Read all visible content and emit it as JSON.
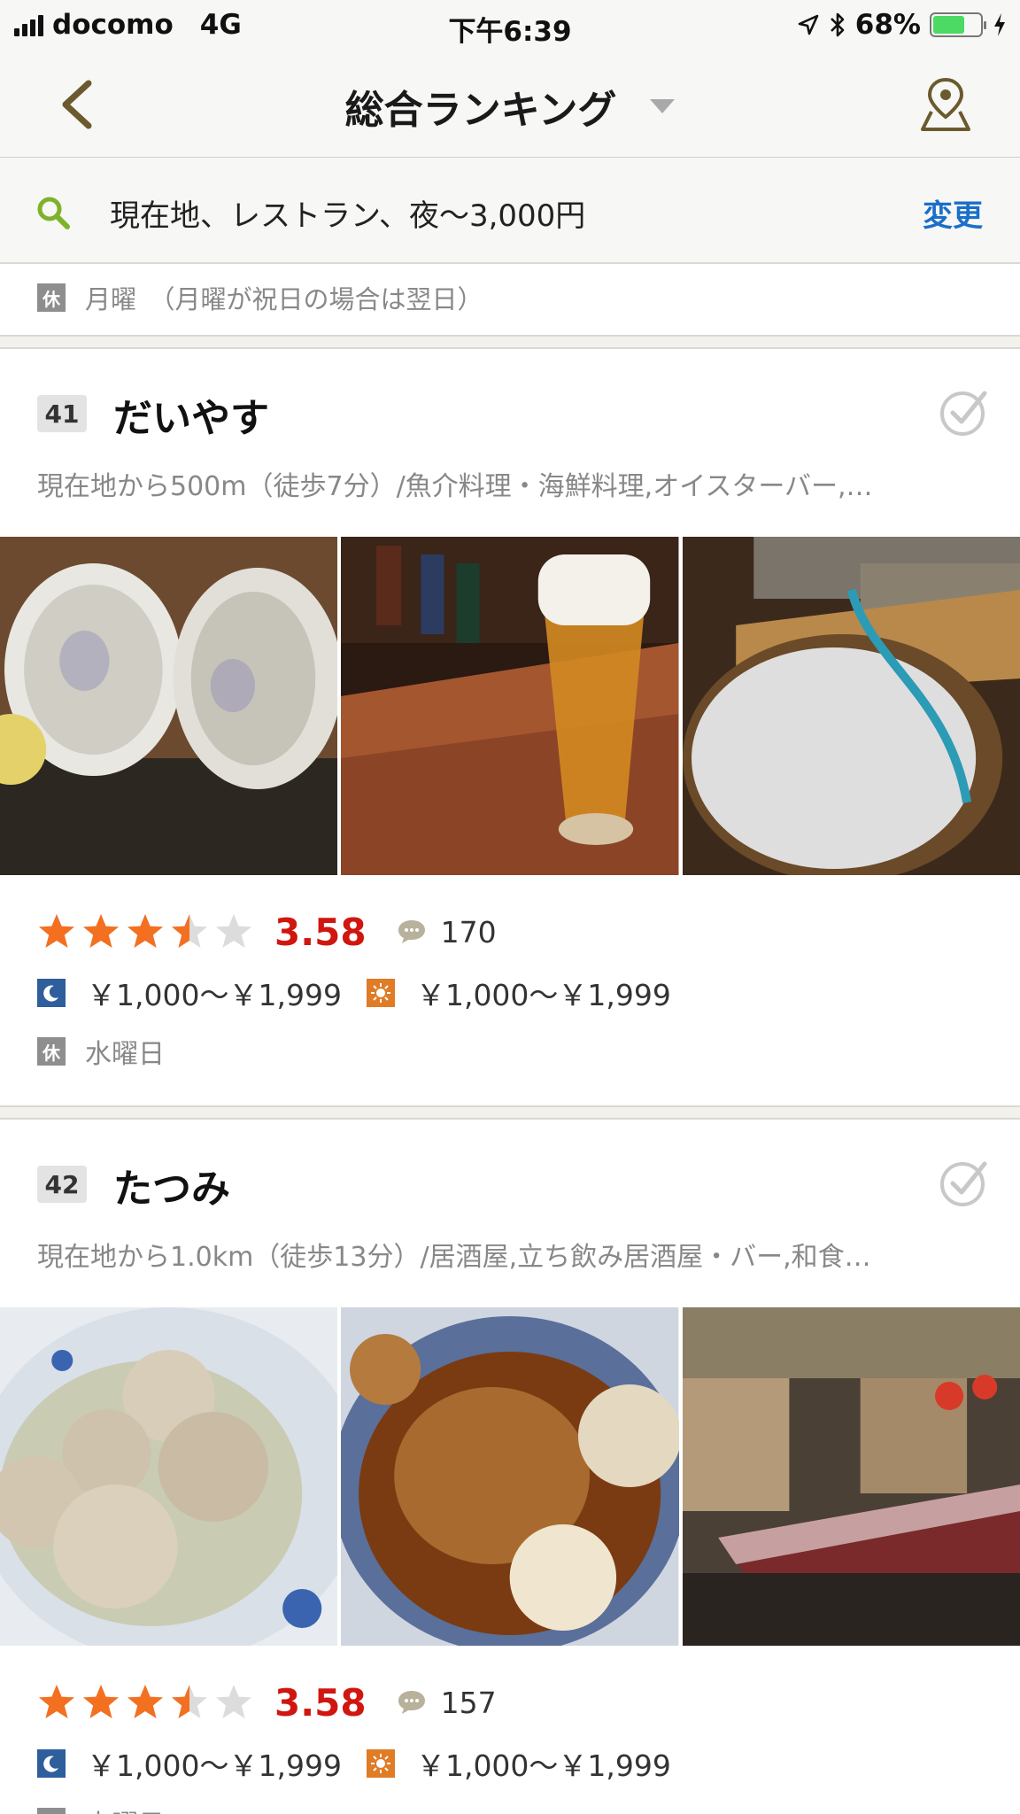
{
  "status_bar": {
    "carrier": "docomo",
    "network": "4G",
    "time": "下午6:39",
    "battery_percent": "68%",
    "battery_level": 0.68
  },
  "nav": {
    "title": "総合ランキング",
    "icons": {
      "back": "chevron-left-icon",
      "map": "map-pin-icon",
      "dropdown": "dropdown-triangle-icon"
    }
  },
  "search": {
    "conditions": "現在地、レストラン、夜〜3,000円",
    "change_label": "変更",
    "icon": "search-icon",
    "accent": "#7fb22b",
    "link_color": "#1a6fc9"
  },
  "previous_card": {
    "holiday_badge": "休",
    "holiday_text": "月曜　（月曜が祝日の場合は翌日）"
  },
  "restaurants": [
    {
      "rank": "41",
      "name": "だいやす",
      "subtitle": "現在地から500m（徒歩7分）/魚介料理・海鮮料理,オイスターバー,…",
      "rating_stars": 3.5,
      "rating_score": "3.58",
      "review_count": "170",
      "dinner_price": "￥1,000〜￥1,999",
      "lunch_price": "￥1,000〜￥1,999",
      "holiday_badge": "休",
      "holiday_text": "水曜日",
      "photos": [
        "oysters",
        "beer",
        "oyster-prep"
      ]
    },
    {
      "rank": "42",
      "name": "たつみ",
      "subtitle": "現在地から1.0km（徒歩13分）/居酒屋,立ち飲み居酒屋・バー,和食…",
      "rating_stars": 3.5,
      "rating_score": "3.58",
      "review_count": "157",
      "dinner_price": "￥1,000〜￥1,999",
      "lunch_price": "￥1,000〜￥1,999",
      "holiday_badge": "休",
      "holiday_text": "木曜日",
      "photos": [
        "dumplings",
        "simmered-fish",
        "interior"
      ]
    }
  ],
  "colors": {
    "score": "#d0160f",
    "star": "#f37021",
    "star_empty": "#dcdcdc",
    "dinner_icon": "#2e5e9c",
    "lunch_icon": "#e07b26"
  }
}
